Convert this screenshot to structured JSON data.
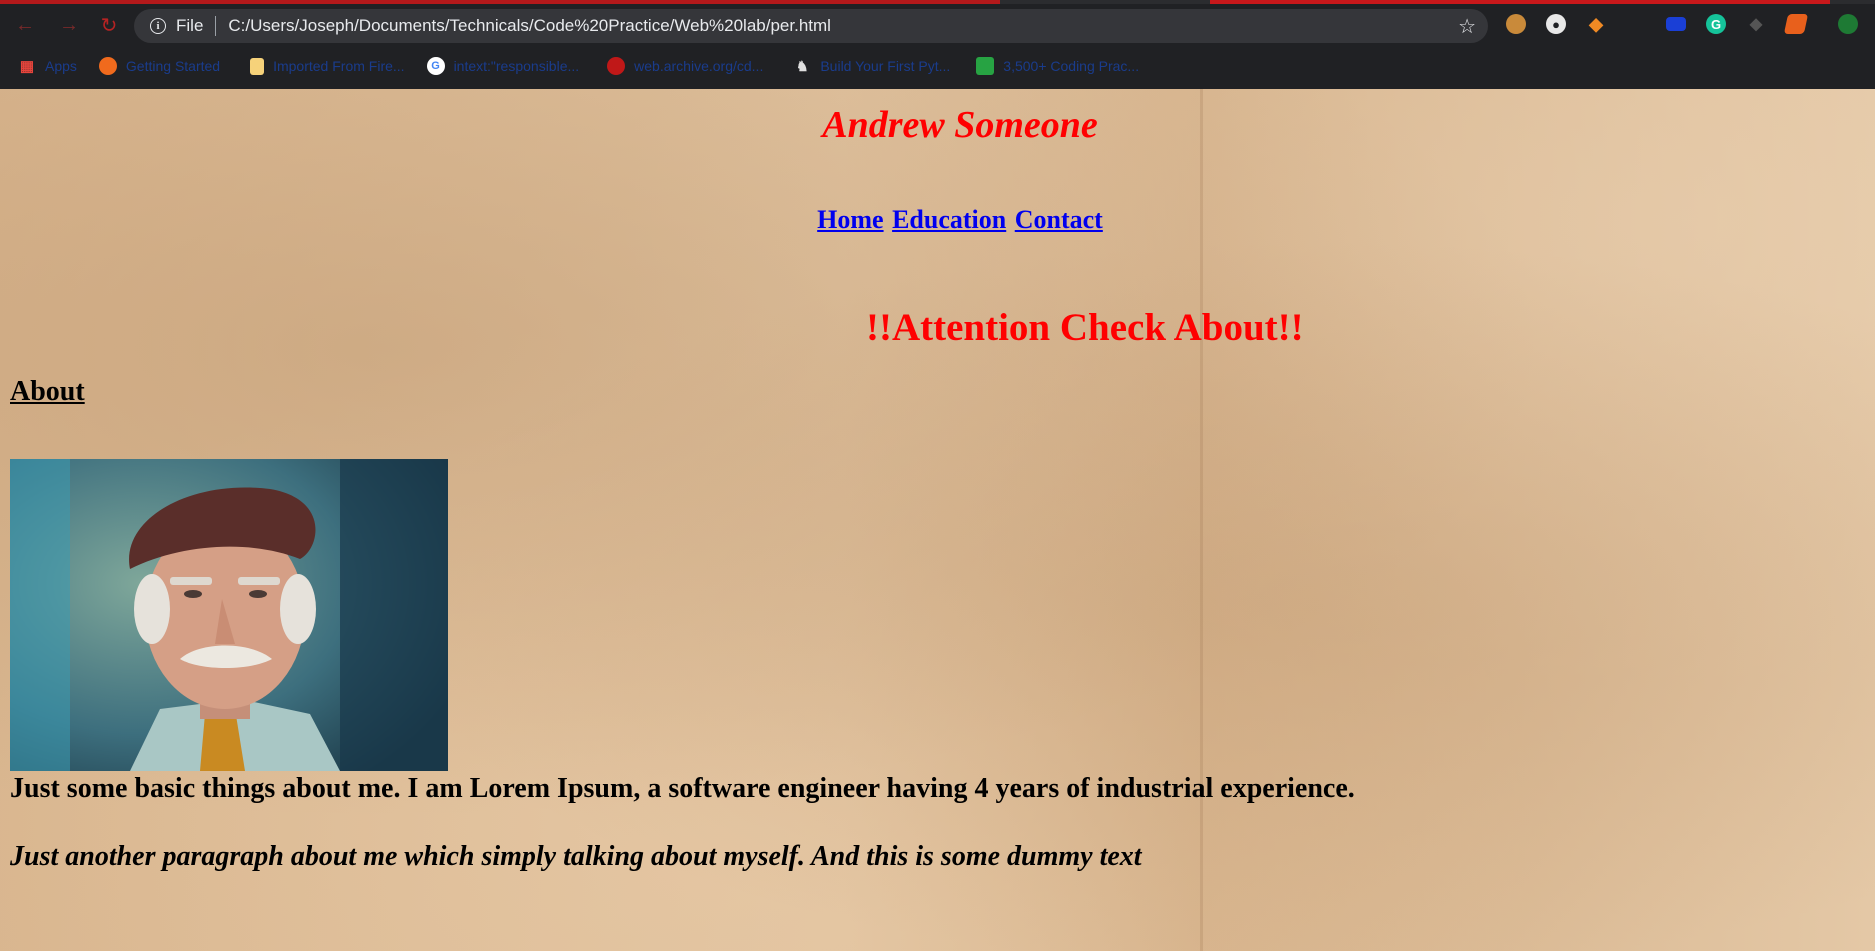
{
  "browser": {
    "address_scheme": "File",
    "address_url": "C:/Users/Joseph/Documents/Technicals/Code%20Practice/Web%20lab/per.html",
    "bookmarks": [
      {
        "label": "Apps",
        "icon": "apps-grid-icon"
      },
      {
        "label": "Getting Started",
        "icon": "firefox-icon"
      },
      {
        "label": "Imported From Fire...",
        "icon": "folder-icon"
      },
      {
        "label": "intext:\"responsible...",
        "icon": "google-icon"
      },
      {
        "label": "web.archive.org/cd...",
        "icon": "archive-icon"
      },
      {
        "label": "Build Your First Pyt...",
        "icon": "python-icon"
      },
      {
        "label": "3,500+ Coding Prac...",
        "icon": "coding-icon"
      }
    ],
    "extensions": [
      "cookie-icon",
      "chat-icon",
      "gitlab-icon",
      "tag-icon",
      "screen-icon",
      "grammarly-icon",
      "diamond-icon",
      "tag-orange-icon",
      "globe-icon"
    ]
  },
  "site": {
    "title": "Andrew Someone",
    "nav": [
      "Home",
      "Education",
      "Contact"
    ],
    "attention": "!!Attention Check About!!",
    "about_heading": "About",
    "paragraph1": "Just some basic things about me. I am Lorem Ipsum, a software engineer having 4 years of industrial experience.",
    "paragraph2": "Just another paragraph about me which simply talking about myself. And this is some dummy text"
  }
}
